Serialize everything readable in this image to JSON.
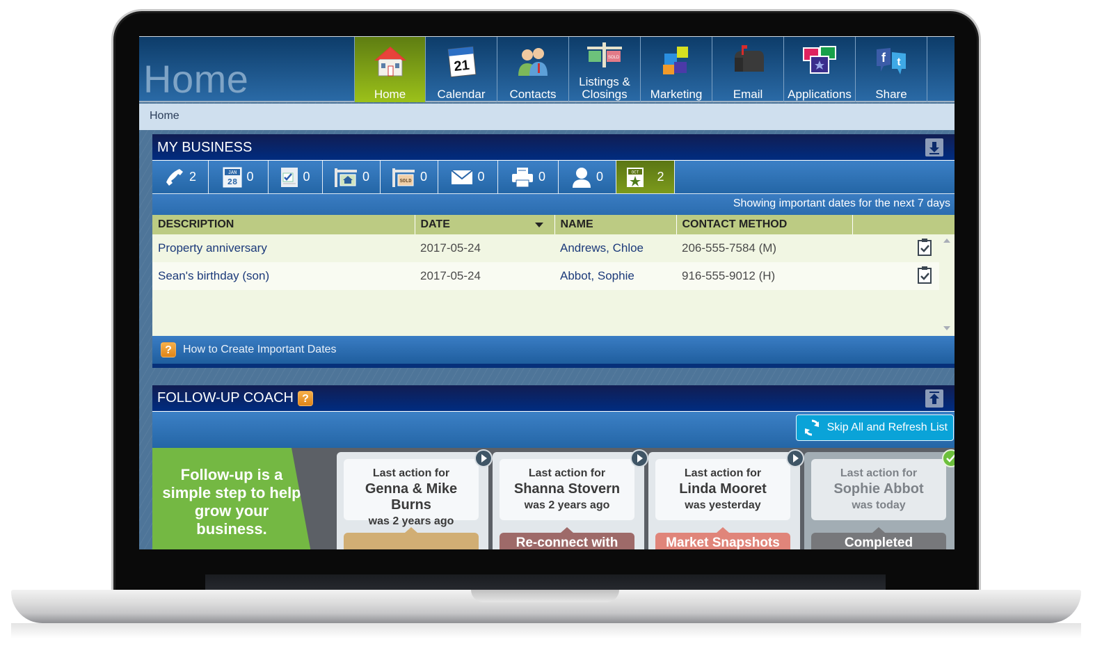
{
  "app": {
    "page_title": "Home",
    "breadcrumb": "Home"
  },
  "nav": {
    "items": [
      {
        "label": "Home",
        "icon": "house-icon",
        "active": true
      },
      {
        "label": "Calendar",
        "icon": "calendar-icon",
        "active": false,
        "icon_text": "21"
      },
      {
        "label": "Contacts",
        "icon": "people-icon",
        "active": false
      },
      {
        "label_line1": "Listings &",
        "label_line2": "Closings",
        "icon": "sold-sign-icon",
        "active": false
      },
      {
        "label": "Marketing",
        "icon": "puzzle-icon",
        "active": false
      },
      {
        "label": "Email",
        "icon": "mailbox-icon",
        "active": false
      },
      {
        "label": "Applications",
        "icon": "apps-icon",
        "active": false
      },
      {
        "label": "Share",
        "icon": "social-share-icon",
        "active": false
      }
    ]
  },
  "my_business": {
    "title": "MY BUSINESS",
    "toggle_icon": "collapse-down-icon",
    "tabs": [
      {
        "icon": "phone-icon",
        "count": "2",
        "active": false
      },
      {
        "icon": "calendar-date-icon",
        "icon_month": "JAN",
        "icon_day": "28",
        "count": "0",
        "active": false
      },
      {
        "icon": "task-checklist-icon",
        "count": "0",
        "active": false
      },
      {
        "icon": "listing-sign-icon",
        "count": "0",
        "active": false
      },
      {
        "icon": "sold-sign-icon",
        "icon_text": "SOLD",
        "count": "0",
        "active": false
      },
      {
        "icon": "envelope-icon",
        "count": "0",
        "active": false
      },
      {
        "icon": "printer-icon",
        "count": "0",
        "active": false
      },
      {
        "icon": "person-icon",
        "count": "0",
        "active": false
      },
      {
        "icon": "important-date-star-icon",
        "icon_month": "OCT",
        "count": "2",
        "active": true
      }
    ],
    "info_text": "Showing important dates for the next 7 days",
    "table": {
      "columns": [
        "DESCRIPTION",
        "DATE",
        "NAME",
        "CONTACT METHOD",
        ""
      ],
      "sorted_column": "DATE",
      "rows": [
        {
          "description": "Property anniversary",
          "date": "2017-05-24",
          "name": "Andrews, Chloe",
          "contact_method": "206-555-7584 (M)",
          "action_icon": "clipboard-check-icon"
        },
        {
          "description": "Sean's birthday (son)",
          "date": "2017-05-24",
          "name": "Abbot, Sophie",
          "contact_method": "916-555-9012 (H)",
          "action_icon": "clipboard-check-icon"
        }
      ]
    },
    "footer_link": "How to Create Important Dates",
    "footer_icon": "help-icon"
  },
  "follow_up_coach": {
    "title": "FOLLOW-UP COACH",
    "help_icon": "help-icon",
    "toggle_icon": "collapse-up-icon",
    "skip_button": "Skip All and Refresh List",
    "intro_text": "Follow-up is a simple step to help grow your business.",
    "cards": [
      {
        "line1": "Last action for",
        "name": "Genna & Mike Burns",
        "when": "was 2 years ago",
        "action": "",
        "action_color": "#d1ae74",
        "status": "pending"
      },
      {
        "line1": "Last action for",
        "name": "Shanna Stovern",
        "when": "was 2 years ago",
        "action": "Re-connect with",
        "action_color": "#9e6a69",
        "status": "pending"
      },
      {
        "line1": "Last action for",
        "name": "Linda Mooret",
        "when": "was yesterday",
        "action": "Market Snapshots",
        "action_color": "#e0857a",
        "status": "pending"
      },
      {
        "line1": "Last action for",
        "name": "Sophie Abbot",
        "when": "was today",
        "action": "Completed",
        "action_color": "#77787b",
        "status": "done"
      }
    ]
  }
}
